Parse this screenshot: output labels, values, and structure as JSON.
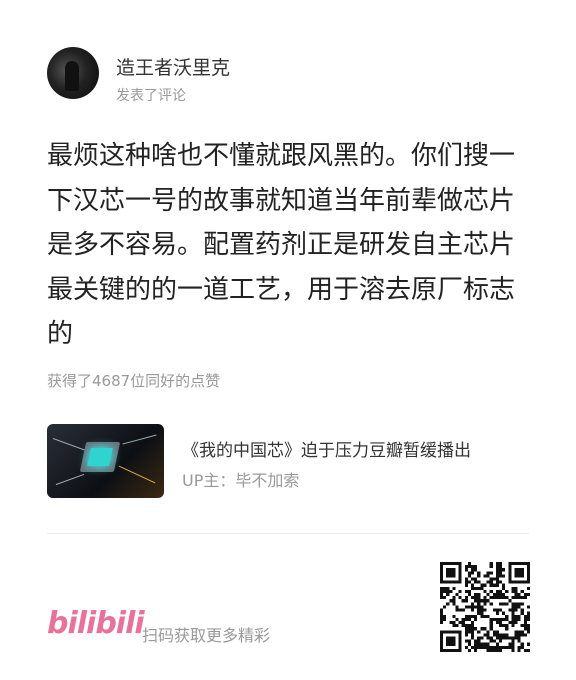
{
  "header": {
    "username": "造王者沃里克",
    "action": "发表了评论",
    "avatar_icon": "user-avatar"
  },
  "comment": {
    "lines": [
      "最烦这种啥也不懂就跟风黑的。你们搜一",
      "下汉芯一号的故事就知道当年前辈做芯片",
      "是多不容易。配置药剂正是研发自主芯片",
      "最关键的的一道工艺，用于溶去原厂标志",
      "的"
    ]
  },
  "likes": "获得了4687位同好的点赞",
  "card": {
    "title": "《我的中国芯》迫于压力豆瓣暂缓播出",
    "up": "UP主：毕不加索",
    "thumb_icon": "chip-image"
  },
  "footer": {
    "logo": "bilibili",
    "scan_text": "扫码获取更多精彩",
    "qr_icon": "qr-code",
    "brand_color": "#e8739a"
  }
}
